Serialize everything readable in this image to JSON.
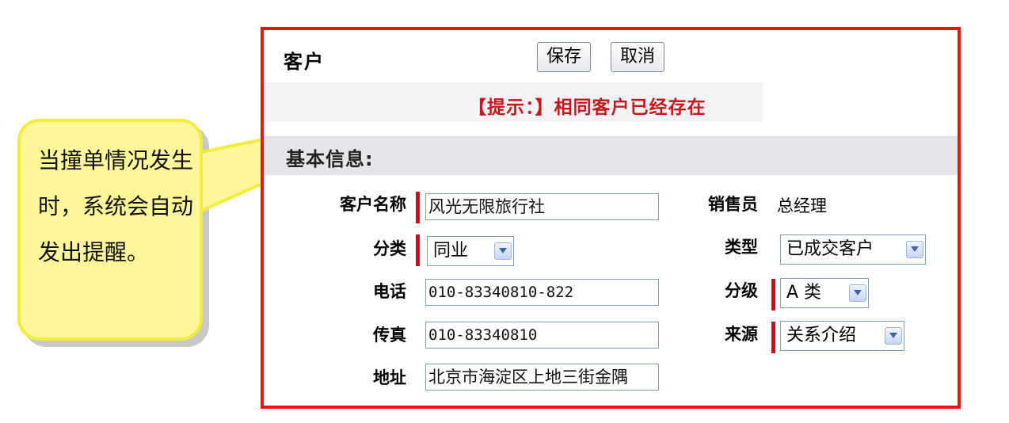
{
  "callout": {
    "text": "当撞单情况发生时，系统会自动发出提醒。"
  },
  "dialog": {
    "title": "客户",
    "buttons": {
      "save": "保存",
      "cancel": "取消"
    },
    "hint": "【提示：】相同客户已经存在",
    "section_title": "基本信息:",
    "fields": {
      "name": {
        "label": "客户名称",
        "value": "风光无限旅行社"
      },
      "category": {
        "label": "分类",
        "value": "同业"
      },
      "phone": {
        "label": "电话",
        "value": "010-83340810-822"
      },
      "fax": {
        "label": "传真",
        "value": "010-83340810"
      },
      "address": {
        "label": "地址",
        "value": "北京市海淀区上地三街金隅"
      },
      "salesperson": {
        "label": "销售员",
        "value": "总经理"
      },
      "type": {
        "label": "类型",
        "value": "已成交客户"
      },
      "grade": {
        "label": "分级",
        "value": "A 类"
      },
      "source": {
        "label": "来源",
        "value": "关系介绍"
      }
    }
  },
  "colors": {
    "border": "#ef1010",
    "hint": "#c8161d",
    "required_mark": "#c3121c",
    "callout_fill": "#fff799"
  }
}
